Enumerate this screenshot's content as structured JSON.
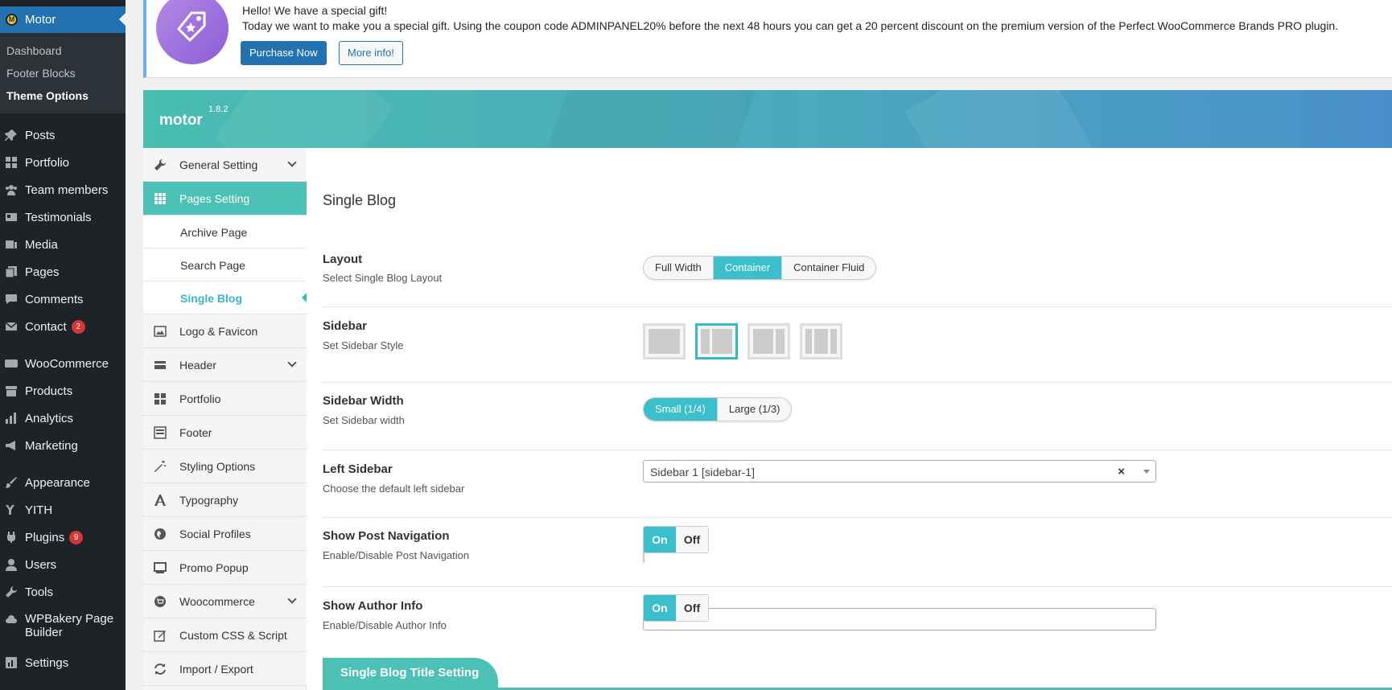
{
  "wp_menu": {
    "active": {
      "label": "Motor",
      "logo_letter": "M"
    },
    "submenu": [
      "Dashboard",
      "Footer Blocks",
      "Theme Options"
    ],
    "items": [
      {
        "label": "Posts",
        "icon": "pin-icon"
      },
      {
        "label": "Portfolio",
        "icon": "grid-icon"
      },
      {
        "label": "Team members",
        "icon": "users-icon"
      },
      {
        "label": "Testimonials",
        "icon": "id-card-icon"
      },
      {
        "label": "Media",
        "icon": "media-icon"
      },
      {
        "label": "Pages",
        "icon": "pages-icon"
      },
      {
        "label": "Comments",
        "icon": "comment-icon"
      },
      {
        "label": "Contact",
        "icon": "mail-icon",
        "badge": "2"
      },
      {
        "label": "WooCommerce",
        "icon": "woo-icon"
      },
      {
        "label": "Products",
        "icon": "archive-icon"
      },
      {
        "label": "Analytics",
        "icon": "bar-chart-icon"
      },
      {
        "label": "Marketing",
        "icon": "megaphone-icon"
      },
      {
        "label": "Appearance",
        "icon": "brush-icon"
      },
      {
        "label": "YITH",
        "icon": "yith-icon"
      },
      {
        "label": "Plugins",
        "icon": "plug-icon",
        "badge": "9"
      },
      {
        "label": "Users",
        "icon": "user-icon"
      },
      {
        "label": "Tools",
        "icon": "wrench-icon"
      },
      {
        "label": "WPBakery Page Builder",
        "icon": "cloud-icon"
      },
      {
        "label": "Settings",
        "icon": "settings-icon"
      }
    ]
  },
  "notice": {
    "title": "Hello! We have a special gift!",
    "message": "Today we want to make you a special gift. Using the coupon code ADMINPANEL20% before the next 48 hours you can get a 20 percent discount on the premium version of the Perfect WooCommerce Brands PRO plugin.",
    "purchase_label": "Purchase Now",
    "more_label": "More info!"
  },
  "theme": {
    "name": "motor",
    "version": "1.8.2"
  },
  "nav": {
    "general": "General Setting",
    "pages": "Pages Setting",
    "archive": "Archive Page",
    "search": "Search Page",
    "single": "Single Blog",
    "logo": "Logo & Favicon",
    "header": "Header",
    "portfolio": "Portfolio",
    "footer": "Footer",
    "styling": "Styling Options",
    "typography": "Typography",
    "social": "Social Profiles",
    "promo": "Promo Popup",
    "woocommerce": "Woocommerce",
    "css": "Custom CSS & Script",
    "import": "Import / Export"
  },
  "main": {
    "section_title": "Single Blog",
    "layout": {
      "title": "Layout",
      "subtitle": "Select Single Blog Layout",
      "options": [
        "Full Width",
        "Container",
        "Container Fluid"
      ],
      "selected": "Container"
    },
    "sidebar": {
      "title": "Sidebar",
      "subtitle": "Set Sidebar Style",
      "selected_index": 1
    },
    "sidebar_width": {
      "title": "Sidebar Width",
      "subtitle": "Set Sidebar width",
      "options": [
        "Small (1/4)",
        "Large (1/3)"
      ],
      "selected": "Small (1/4)"
    },
    "left_sidebar": {
      "title": "Left Sidebar",
      "subtitle": "Choose the default left sidebar",
      "value": "Sidebar 1 [sidebar-1]",
      "clear": "×"
    },
    "post_nav": {
      "title": "Show Post Navigation",
      "subtitle": "Enable/Disable Post Navigation",
      "on": "On",
      "off": "Off",
      "value": "On"
    },
    "author": {
      "title": "Show Author Info",
      "subtitle": "Enable/Disable Author Info",
      "on": "On",
      "off": "Off",
      "value": "On"
    },
    "tab_label": "Single Blog Title Setting"
  },
  "colors": {
    "accent": "#3bbfcc",
    "nav_active": "#4dc1b5",
    "wp_primary": "#2271b1",
    "wp_dark": "#1d2327"
  }
}
